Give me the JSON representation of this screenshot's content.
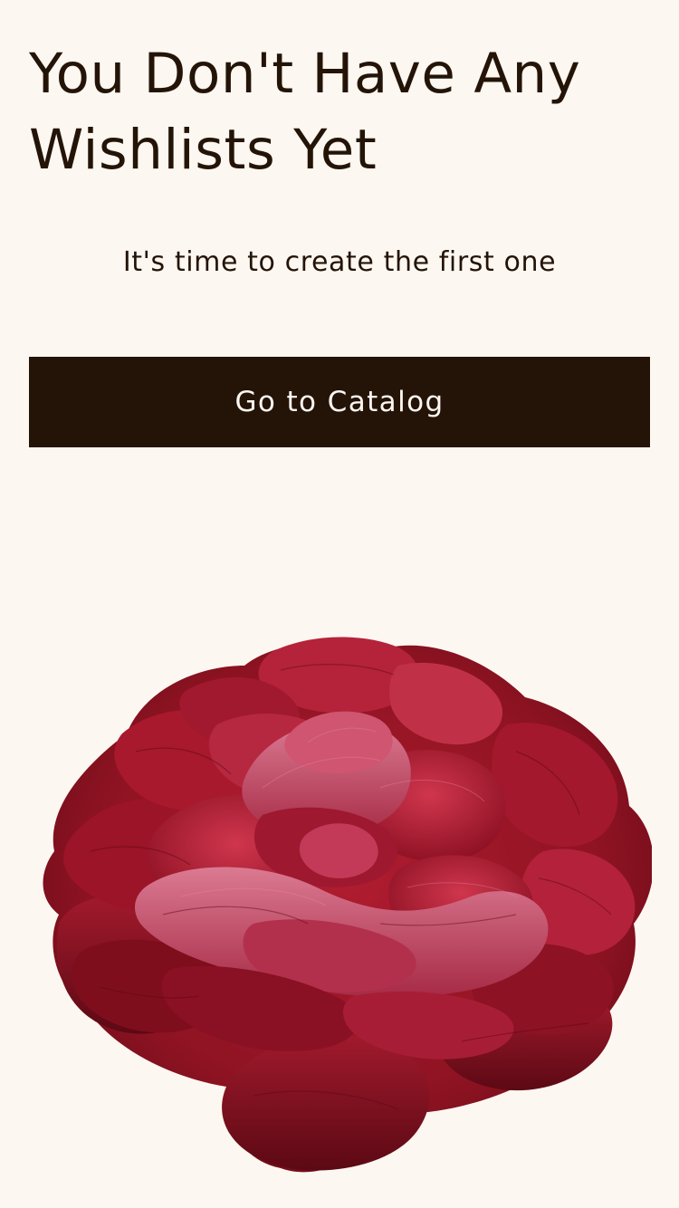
{
  "empty_state": {
    "title": "You Don't Have Any Wishlists Yet",
    "message": "It's time to create the first one"
  },
  "actions": {
    "catalog_label": "Go to Catalog"
  },
  "illustration": {
    "icon": "peony-illustration",
    "colors": {
      "petal_dark": "#7a0f1c",
      "petal_mid": "#a3162a",
      "petal_light": "#c94a66",
      "petal_highlight": "#d9708a"
    }
  },
  "theme": {
    "background": "#fcf7f1",
    "text": "#241408",
    "button_background": "#241408",
    "button_text": "#fcf7f1"
  }
}
